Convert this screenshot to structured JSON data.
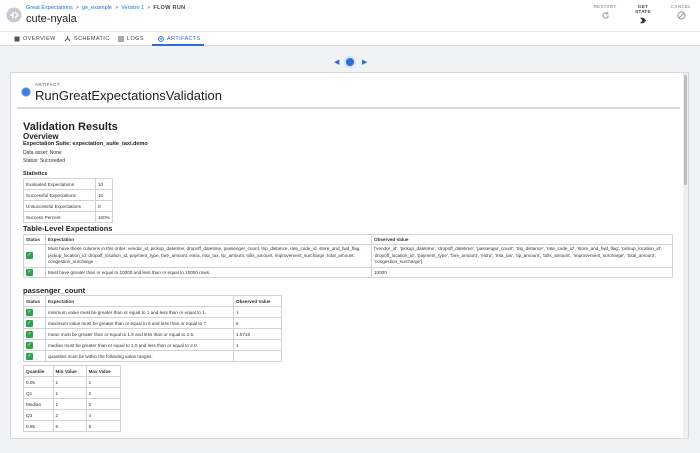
{
  "header": {
    "breadcrumb": [
      "Great Expectations",
      "ge_example",
      "Version 1",
      "FLOW RUN"
    ],
    "run_name": "cute-nyala",
    "actions": [
      {
        "label": "RESTART",
        "icon": "restart-icon"
      },
      {
        "label": "GET STATE",
        "icon": "get-state-icon"
      },
      {
        "label": "CANCEL",
        "icon": "cancel-icon"
      }
    ]
  },
  "tabs": [
    {
      "label": "OVERVIEW",
      "icon": "overview-icon"
    },
    {
      "label": "SCHEMATIC",
      "icon": "schematic-icon"
    },
    {
      "label": "LOGS",
      "icon": "logs-icon"
    },
    {
      "label": "ARTIFACTS",
      "icon": "artifacts-icon",
      "active": true
    }
  ],
  "artifact": {
    "label": "ARTIFACT",
    "title": "RunGreatExpectationsValidation"
  },
  "report": {
    "title": "Validation Results",
    "overview": "Overview",
    "suite": "Expectation Suite: expectation_suite_taxi.demo",
    "data_asset": "Data asset: None",
    "status": "Status: Succeeded",
    "stats_heading": "Statistics",
    "stats": [
      [
        "Evaluated Expectations",
        "10"
      ],
      [
        "Successful Expectations",
        "10"
      ],
      [
        "Unsuccessful Expectations",
        "0"
      ],
      [
        "Success Percent",
        "100%"
      ]
    ],
    "table_level_heading": "Table-Level Expectations",
    "table_level_headers": [
      "Status",
      "Expectation",
      "Observed Value"
    ],
    "table_level_rows": [
      {
        "expectation": "Must have these columns in this order: vendor_id, pickup_datetime, dropoff_datetime, passenger_count, trip_distance, rate_code_id, store_and_fwd_flag, pickup_location_id, dropoff_location_id, payment_type, fare_amount, extra, mta_tax, tip_amount, tolls_amount, improvement_surcharge, total_amount, congestion_surcharge",
        "observed": "['vendor_id', 'pickup_datetime', 'dropoff_datetime', 'passenger_count', 'trip_distance', 'rate_code_id', 'store_and_fwd_flag', 'pickup_location_id', 'dropoff_location_id', 'payment_type', 'fare_amount', 'extra', 'mta_tax', 'tip_amount', 'tolls_amount', 'improvement_surcharge', 'total_amount', 'congestion_surcharge']"
      },
      {
        "expectation": "Must have greater than or equal to 10000 and less than or equal to 10000 rows.",
        "observed": "10000"
      }
    ],
    "column_heading": "passenger_count",
    "column_headers": [
      "Status",
      "Expectation",
      "Observed Value"
    ],
    "column_rows": [
      {
        "expectation": "minimum value must be greater than or equal to 1 and less than or equal to 1.",
        "observed": "1"
      },
      {
        "expectation": "maximum value must be greater than or equal to 6 and less than or equal to 7",
        "observed": "6"
      },
      {
        "expectation": "mean must be greater than or equal to 1.5 and less than or equal to 2.5.",
        "observed": "1.5716"
      },
      {
        "expectation": "median must be greater than or equal to 1.0 and less than or equal to 2.0.",
        "observed": "1"
      },
      {
        "expectation": "quantiles must be within the following value ranges.",
        "observed": ""
      }
    ],
    "quantile_headers": [
      "Quantile",
      "Min Value",
      "Max Value"
    ],
    "quantile_rows": [
      [
        "0.05",
        "1",
        "1"
      ],
      [
        "Q1",
        "1",
        "2"
      ],
      [
        "Median",
        "1",
        "2"
      ],
      [
        "Q3",
        "2",
        "4"
      ],
      [
        "0.95",
        "5",
        "6"
      ]
    ]
  },
  "colors": {
    "accent": "#2b6fd6",
    "success": "#2ea44f"
  }
}
